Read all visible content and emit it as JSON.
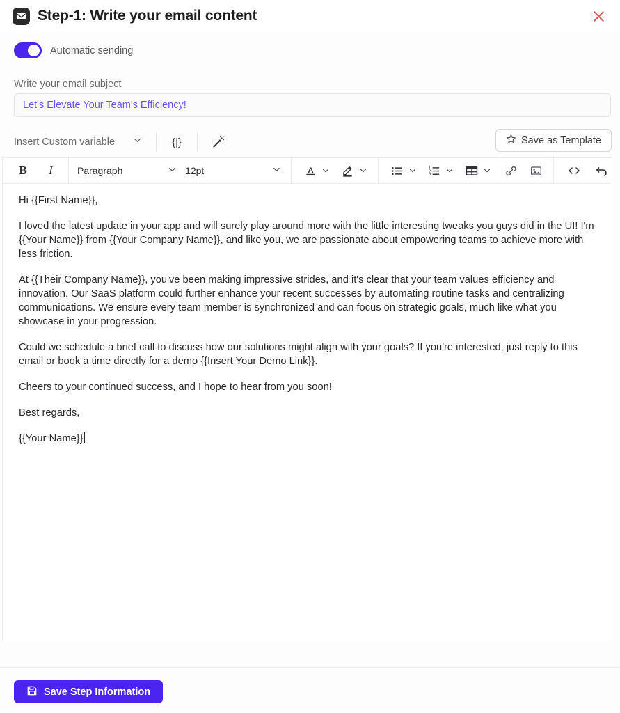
{
  "header": {
    "icon": "envelope-icon",
    "title": "Step-1: Write your email content",
    "close_icon": "close-icon",
    "close_color": "#e05050"
  },
  "automatic_sending": {
    "label": "Automatic sending",
    "enabled": true,
    "accent_color": "#4b24f0"
  },
  "subject": {
    "label": "Write your email subject",
    "value": "Let's Elevate Your Team's Efficiency!",
    "placeholder": "Write your email subject",
    "text_color": "#6b57f0"
  },
  "variable_bar": {
    "insert_variable_label": "Insert Custom variable",
    "chevron_icon": "chevron-down-icon",
    "braces_icon": "{|}",
    "magic_wand_icon": "magic-wand-icon",
    "save_template_label": "Save as Template",
    "star_icon": "star-icon"
  },
  "format_toolbar": {
    "bold": "B",
    "italic": "I",
    "block_format": "Paragraph",
    "font_size": "12pt",
    "text_color_icon": "text-color-icon",
    "highlight_icon": "highlight-color-icon",
    "bullet_list_icon": "bullet-list-icon",
    "numbered_list_icon": "numbered-list-icon",
    "table_icon": "table-icon",
    "link_icon": "link-icon",
    "image_icon": "image-icon",
    "code_icon": "source-code-icon",
    "undo_icon": "undo-icon"
  },
  "email_body": {
    "paragraphs": [
      "Hi {{First Name}},",
      "I loved the latest update in your app and will surely play around more with the little interesting tweaks you guys did in the UI! I'm {{Your Name}} from {{Your Company Name}}, and like you, we are passionate about empowering teams to achieve more with less friction.",
      "At {{Their Company Name}}, you've been making impressive strides, and it's clear that your team values efficiency and innovation. Our SaaS platform could further enhance your recent successes by automating routine tasks and centralizing communications. We ensure every team member is synchronized and can focus on strategic goals, much like what you showcase in your progression.",
      "Could we schedule a brief call to discuss how our solutions might align with your goals? If you're interested, just reply to this email or book a time directly for a demo {{Insert Your Demo Link}}.",
      "Cheers to your continued success, and I hope to hear from you soon!",
      "Best regards,",
      "{{Your Name}}"
    ]
  },
  "footer": {
    "save_step_label": "Save Step Information",
    "save_icon": "floppy-disk-icon",
    "button_color": "#4b24f0"
  }
}
